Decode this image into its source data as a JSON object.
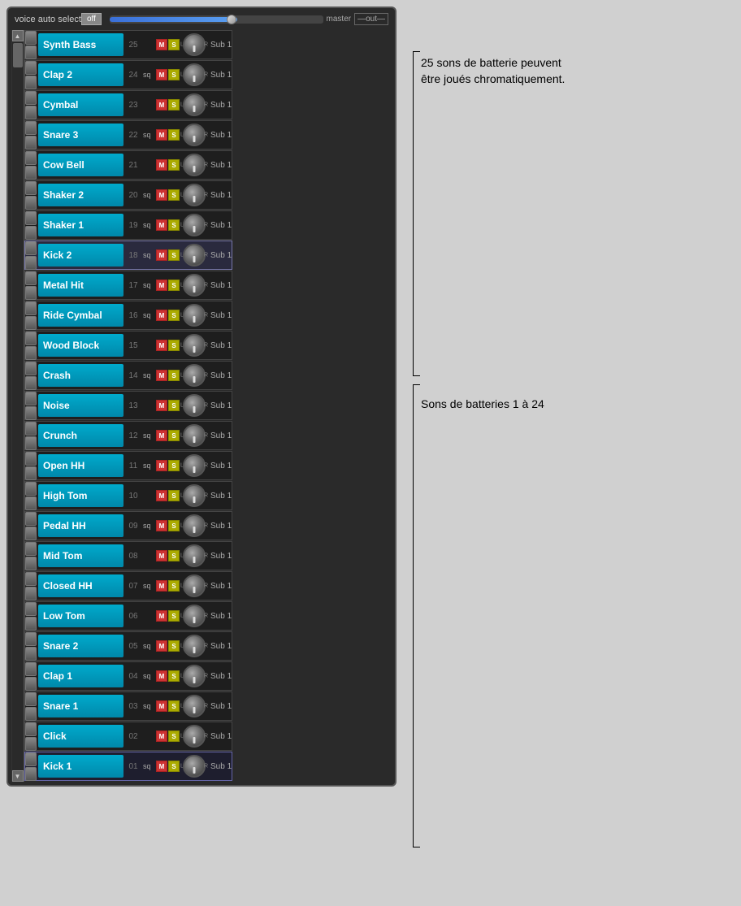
{
  "header": {
    "voice_auto_label": "voice auto select",
    "off_button": "off",
    "master_label": "master",
    "out_label": "—out—"
  },
  "annotations": {
    "top_text": "25 sons de batterie peuvent\nêtre joués chromatiquement.",
    "mid_text": "Sons de batteries 1 à 24"
  },
  "channels": [
    {
      "id": "synth-bass",
      "name": "Synth Bass",
      "num": "25",
      "sq": false,
      "sub": "Sub 1",
      "selected": false
    },
    {
      "id": "clap-2",
      "name": "Clap 2",
      "num": "24",
      "sq": true,
      "sub": "Sub 1",
      "selected": false
    },
    {
      "id": "cymbal",
      "name": "Cymbal",
      "num": "23",
      "sq": false,
      "sub": "Sub 1",
      "selected": false
    },
    {
      "id": "snare-3",
      "name": "Snare 3",
      "num": "22",
      "sq": true,
      "sub": "Sub 1",
      "selected": false
    },
    {
      "id": "cow-bell",
      "name": "Cow Bell",
      "num": "21",
      "sq": false,
      "sub": "Sub 1",
      "selected": false
    },
    {
      "id": "shaker-2",
      "name": "Shaker 2",
      "num": "20",
      "sq": true,
      "sub": "Sub 1",
      "selected": false
    },
    {
      "id": "shaker-1",
      "name": "Shaker 1",
      "num": "19",
      "sq": true,
      "sub": "Sub 1",
      "selected": false
    },
    {
      "id": "kick-2",
      "name": "Kick 2",
      "num": "18",
      "sq": true,
      "sub": "Sub 1",
      "selected": true
    },
    {
      "id": "metal-hit",
      "name": "Metal Hit",
      "num": "17",
      "sq": true,
      "sub": "Sub 1",
      "selected": false
    },
    {
      "id": "ride-cymbal",
      "name": "Ride Cymbal",
      "num": "16",
      "sq": true,
      "sub": "Sub 1",
      "selected": false
    },
    {
      "id": "wood-block",
      "name": "Wood Block",
      "num": "15",
      "sq": false,
      "sub": "Sub 1",
      "selected": false
    },
    {
      "id": "crash",
      "name": "Crash",
      "num": "14",
      "sq": true,
      "sub": "Sub 1",
      "selected": false
    },
    {
      "id": "noise",
      "name": "Noise",
      "num": "13",
      "sq": false,
      "sub": "Sub 1",
      "selected": false
    },
    {
      "id": "crunch",
      "name": "Crunch",
      "num": "12",
      "sq": true,
      "sub": "Sub 1",
      "selected": false
    },
    {
      "id": "open-hh",
      "name": "Open HH",
      "num": "11",
      "sq": true,
      "sub": "Sub 1",
      "selected": false
    },
    {
      "id": "high-tom",
      "name": "High Tom",
      "num": "10",
      "sq": false,
      "sub": "Sub 1",
      "selected": false
    },
    {
      "id": "pedal-hh",
      "name": "Pedal HH",
      "num": "09",
      "sq": true,
      "sub": "Sub 1",
      "selected": false
    },
    {
      "id": "mid-tom",
      "name": "Mid Tom",
      "num": "08",
      "sq": false,
      "sub": "Sub 1",
      "selected": false
    },
    {
      "id": "closed-hh",
      "name": "Closed HH",
      "num": "07",
      "sq": true,
      "sub": "Sub 1",
      "selected": false
    },
    {
      "id": "low-tom",
      "name": "Low Tom",
      "num": "06",
      "sq": false,
      "sub": "Sub 1",
      "selected": false
    },
    {
      "id": "snare-2",
      "name": "Snare 2",
      "num": "05",
      "sq": true,
      "sub": "Sub 1",
      "selected": false
    },
    {
      "id": "clap-1",
      "name": "Clap 1",
      "num": "04",
      "sq": true,
      "sub": "Sub 1",
      "selected": false
    },
    {
      "id": "snare-1",
      "name": "Snare 1",
      "num": "03",
      "sq": true,
      "sub": "Sub 1",
      "selected": false
    },
    {
      "id": "click",
      "name": "Click",
      "num": "02",
      "sq": false,
      "sub": "Sub 1",
      "selected": false
    },
    {
      "id": "kick-1",
      "name": "Kick 1",
      "num": "01",
      "sq": true,
      "sub": "Sub 1",
      "selected": false,
      "last": true
    }
  ],
  "labels": {
    "m": "M",
    "s": "S",
    "l": "L",
    "r": "R"
  }
}
